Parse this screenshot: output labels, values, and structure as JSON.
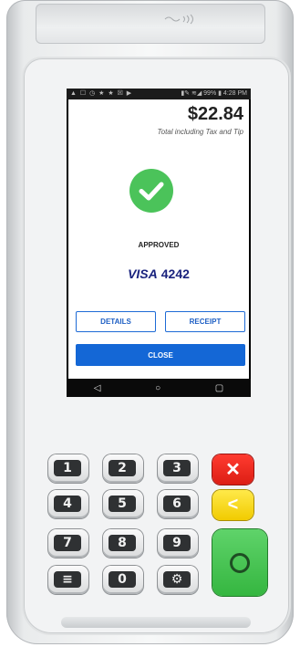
{
  "device": {
    "status_bar": {
      "left_icons": "▲ ☐ ◷ ★ ★ ☒ ▶",
      "right_text": "▮✎ ≋◢ 99% ▮ 4:28 PM"
    },
    "screen": {
      "amount": "$22.84",
      "subtitle": "Total including Tax and Tip",
      "status_icon": "check-circle-icon",
      "status_text": "APPROVED",
      "card_brand": "VISA",
      "card_last4": "4242",
      "details_label": "DETAILS",
      "receipt_label": "RECEIPT",
      "close_label": "CLOSE",
      "nav": {
        "back": "◁",
        "home": "○",
        "recents": "▢"
      }
    },
    "keypad": {
      "rows": [
        [
          "1",
          "2",
          "3"
        ],
        [
          "4",
          "5",
          "6"
        ],
        [
          "7",
          "8",
          "9"
        ],
        [
          "≡",
          "0",
          "⚙"
        ]
      ],
      "cancel_symbol": "✕",
      "clear_symbol": "<",
      "enter_symbol": "○"
    },
    "colors": {
      "accent_blue": "#1467d6",
      "success_green": "#4bc35a",
      "cancel_red": "#e52b1f",
      "clear_yellow": "#f6d90f",
      "enter_green": "#3ec049"
    }
  }
}
